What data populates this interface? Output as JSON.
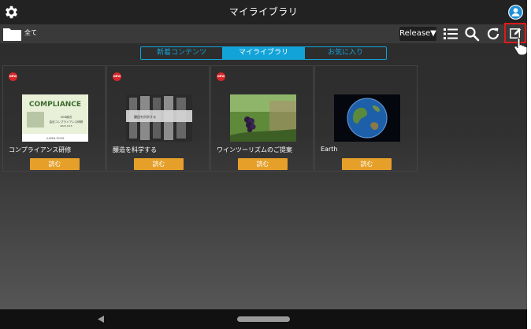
{
  "app": {
    "title": "マイライブラリ"
  },
  "toolbar": {
    "folder_label": "全て",
    "release_label": "Release▼"
  },
  "tabs": [
    {
      "label": "新着コンテンツ",
      "active": false
    },
    {
      "label": "マイライブラリ",
      "active": true
    },
    {
      "label": "お気に入り",
      "active": false
    }
  ],
  "cards": [
    {
      "badge": "NEW",
      "title": "コンプライアンス研修",
      "button": "読む",
      "thumb_heading": "COMPLIANCE",
      "thumb_lines": [
        "CEN株式",
        "会社コンプライアンス研修",
        "2021.9.15"
      ],
      "thumb_footer": "LUMEN FROM"
    },
    {
      "badge": "NEW",
      "title": "醸造を科学する",
      "button": "読む",
      "thumb_caption": "醸造を科学する"
    },
    {
      "badge": "NEW",
      "title": "ワインツーリズムのご提案",
      "button": "読む"
    },
    {
      "badge": "",
      "title": "Earth",
      "button": "読む"
    }
  ],
  "colors": {
    "accent": "#12a3d9",
    "button": "#e6a02a",
    "badge": "#d8262a",
    "highlight": "#e0191a"
  },
  "icons": [
    "settings-gear-icon",
    "account-icon",
    "folder-icon",
    "list-icon",
    "search-icon",
    "refresh-icon",
    "edit-icon",
    "hand-cursor-icon",
    "back-icon"
  ]
}
